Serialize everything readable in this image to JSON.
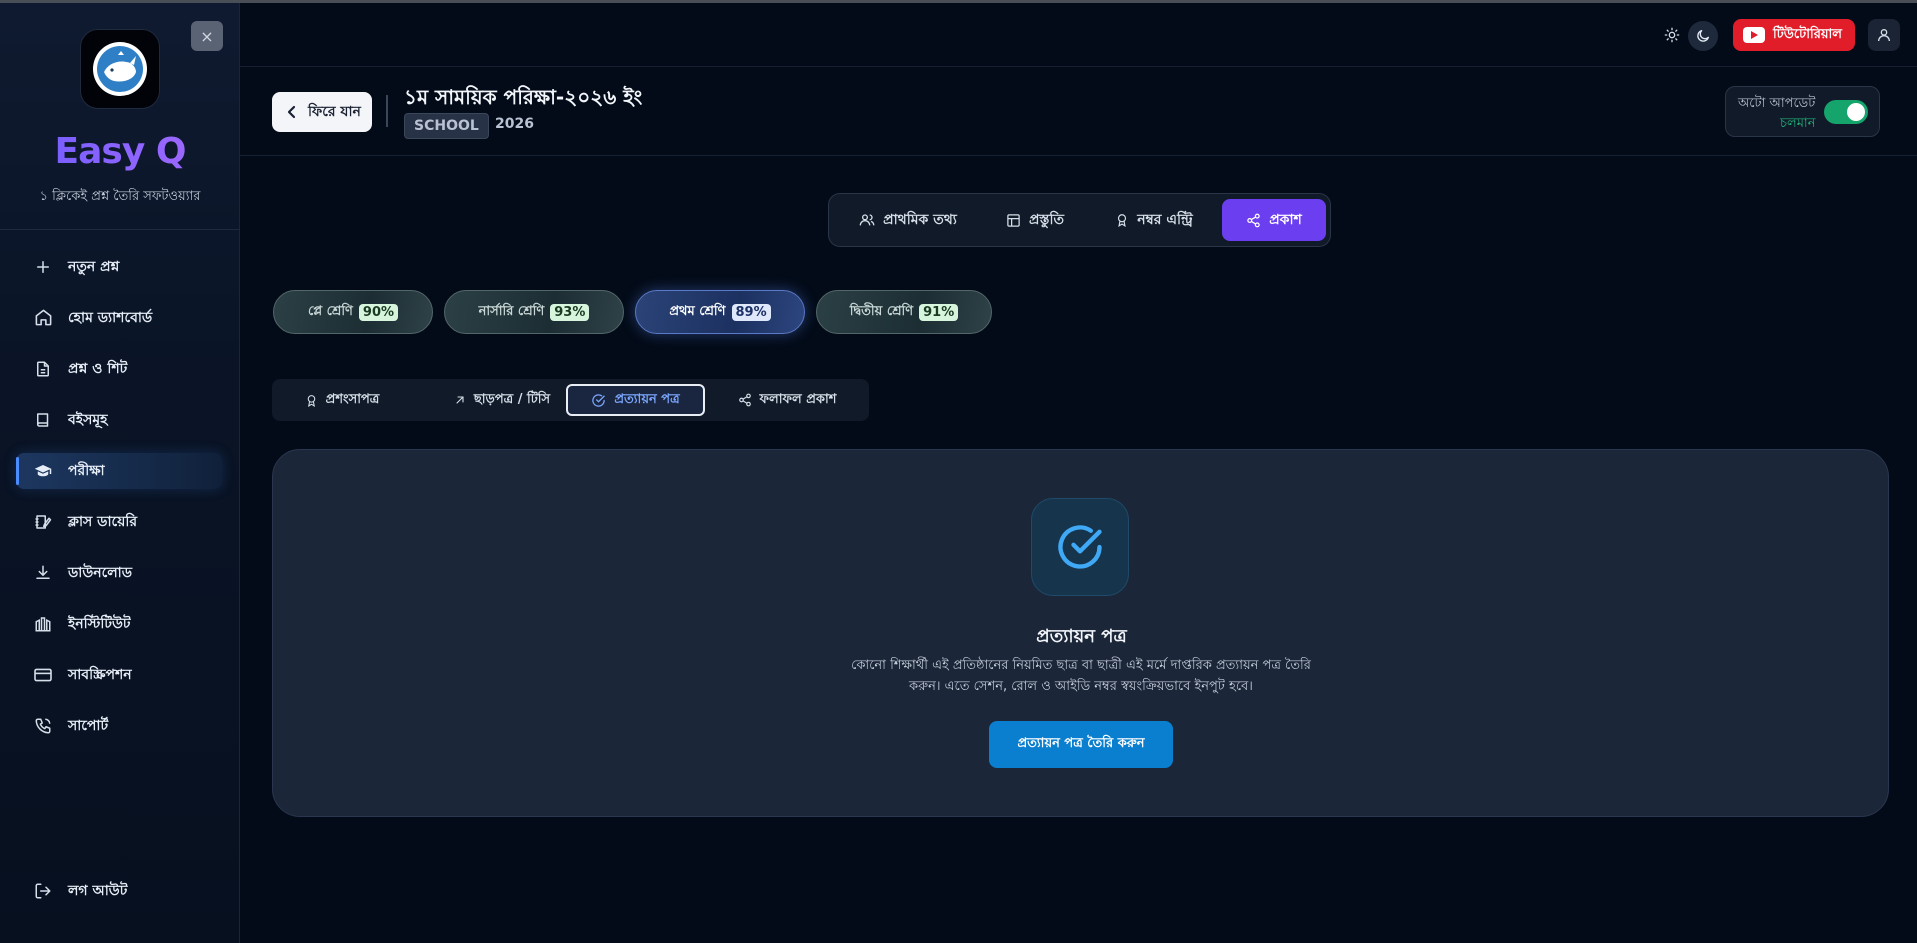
{
  "sidebar": {
    "brand": "Easy Q",
    "tagline": "১ ক্লিকেই প্রশ্ন তৈরি সফটওয়্যার",
    "close_icon": "×",
    "items": [
      {
        "label": "নতুন প্রশ্ন",
        "icon": "plus-icon"
      },
      {
        "label": "হোম ড্যাশবোর্ড",
        "icon": "home-icon"
      },
      {
        "label": "প্রশ্ন ও শিট",
        "icon": "file-icon"
      },
      {
        "label": "বইসমূহ",
        "icon": "book-icon"
      },
      {
        "label": "পরীক্ষা",
        "icon": "graduation-cap-icon",
        "active": true
      },
      {
        "label": "ক্লাস ডায়েরি",
        "icon": "diary-icon"
      },
      {
        "label": "ডাউনলোড",
        "icon": "download-icon"
      },
      {
        "label": "ইনস্টিটিউট",
        "icon": "institute-icon"
      },
      {
        "label": "সাবস্ক্রিপশন",
        "icon": "card-icon"
      },
      {
        "label": "সাপোর্ট",
        "icon": "phone-icon"
      }
    ],
    "logout": "লগ আউট"
  },
  "topbar": {
    "tutorial_label": "টিউটোরিয়াল"
  },
  "header": {
    "back_label": "ফিরে যান",
    "title": "১ম সাময়িক পরিক্ষা-২০২৬ ইং",
    "badge": "SCHOOL",
    "year": "2026",
    "auto_update_label": "অটো আপডেট",
    "auto_update_status": "চলমান",
    "auto_update_on": true
  },
  "main_tabs": [
    {
      "label": "প্রাথমিক তথ্য",
      "icon": "users-icon"
    },
    {
      "label": "প্রস্তুতি",
      "icon": "layout-icon"
    },
    {
      "label": "নম্বর এন্ট্রি",
      "icon": "award-icon"
    },
    {
      "label": "প্রকাশ",
      "icon": "share-icon",
      "active": true
    }
  ],
  "class_pills": [
    {
      "label": "প্লে শ্রেণি",
      "pct": "90%"
    },
    {
      "label": "নার্সারি শ্রেণি",
      "pct": "93%"
    },
    {
      "label": "প্রথম শ্রেণি",
      "pct": "89%",
      "active": true
    },
    {
      "label": "দ্বিতীয় শ্রেণি",
      "pct": "91%"
    }
  ],
  "sub_tabs": [
    {
      "label": "প্রশংসাপত্র",
      "icon": "award-icon"
    },
    {
      "label": "ছাড়পত্র / টিসি",
      "icon": "arrow-up-right-icon"
    },
    {
      "label": "প্রত্যায়ন পত্র",
      "icon": "check-circle-icon",
      "active": true
    },
    {
      "label": "ফলাফল প্রকাশ",
      "icon": "share-icon"
    }
  ],
  "card": {
    "title": "প্রত্যায়ন পত্র",
    "description_line1": "কোনো শিক্ষার্থী এই প্রতিষ্ঠানের নিয়মিত ছাত্র বা ছাত্রী এই মর্মে দাপ্তরিক প্রত্যায়ন পত্র তৈরি",
    "description_line2": "করুন। এতে সেশন, রোল ও আইডি নম্বর স্বয়ংক্রিয়ভাবে ইনপুট হবে।",
    "button": "প্রত্যায়ন পত্র তৈরি করুন"
  },
  "colors": {
    "accent": "#6b3ff0",
    "primary_button": "#0a7fcf",
    "toggle_on": "#15a46b",
    "tutorial": "#e11d2a"
  }
}
